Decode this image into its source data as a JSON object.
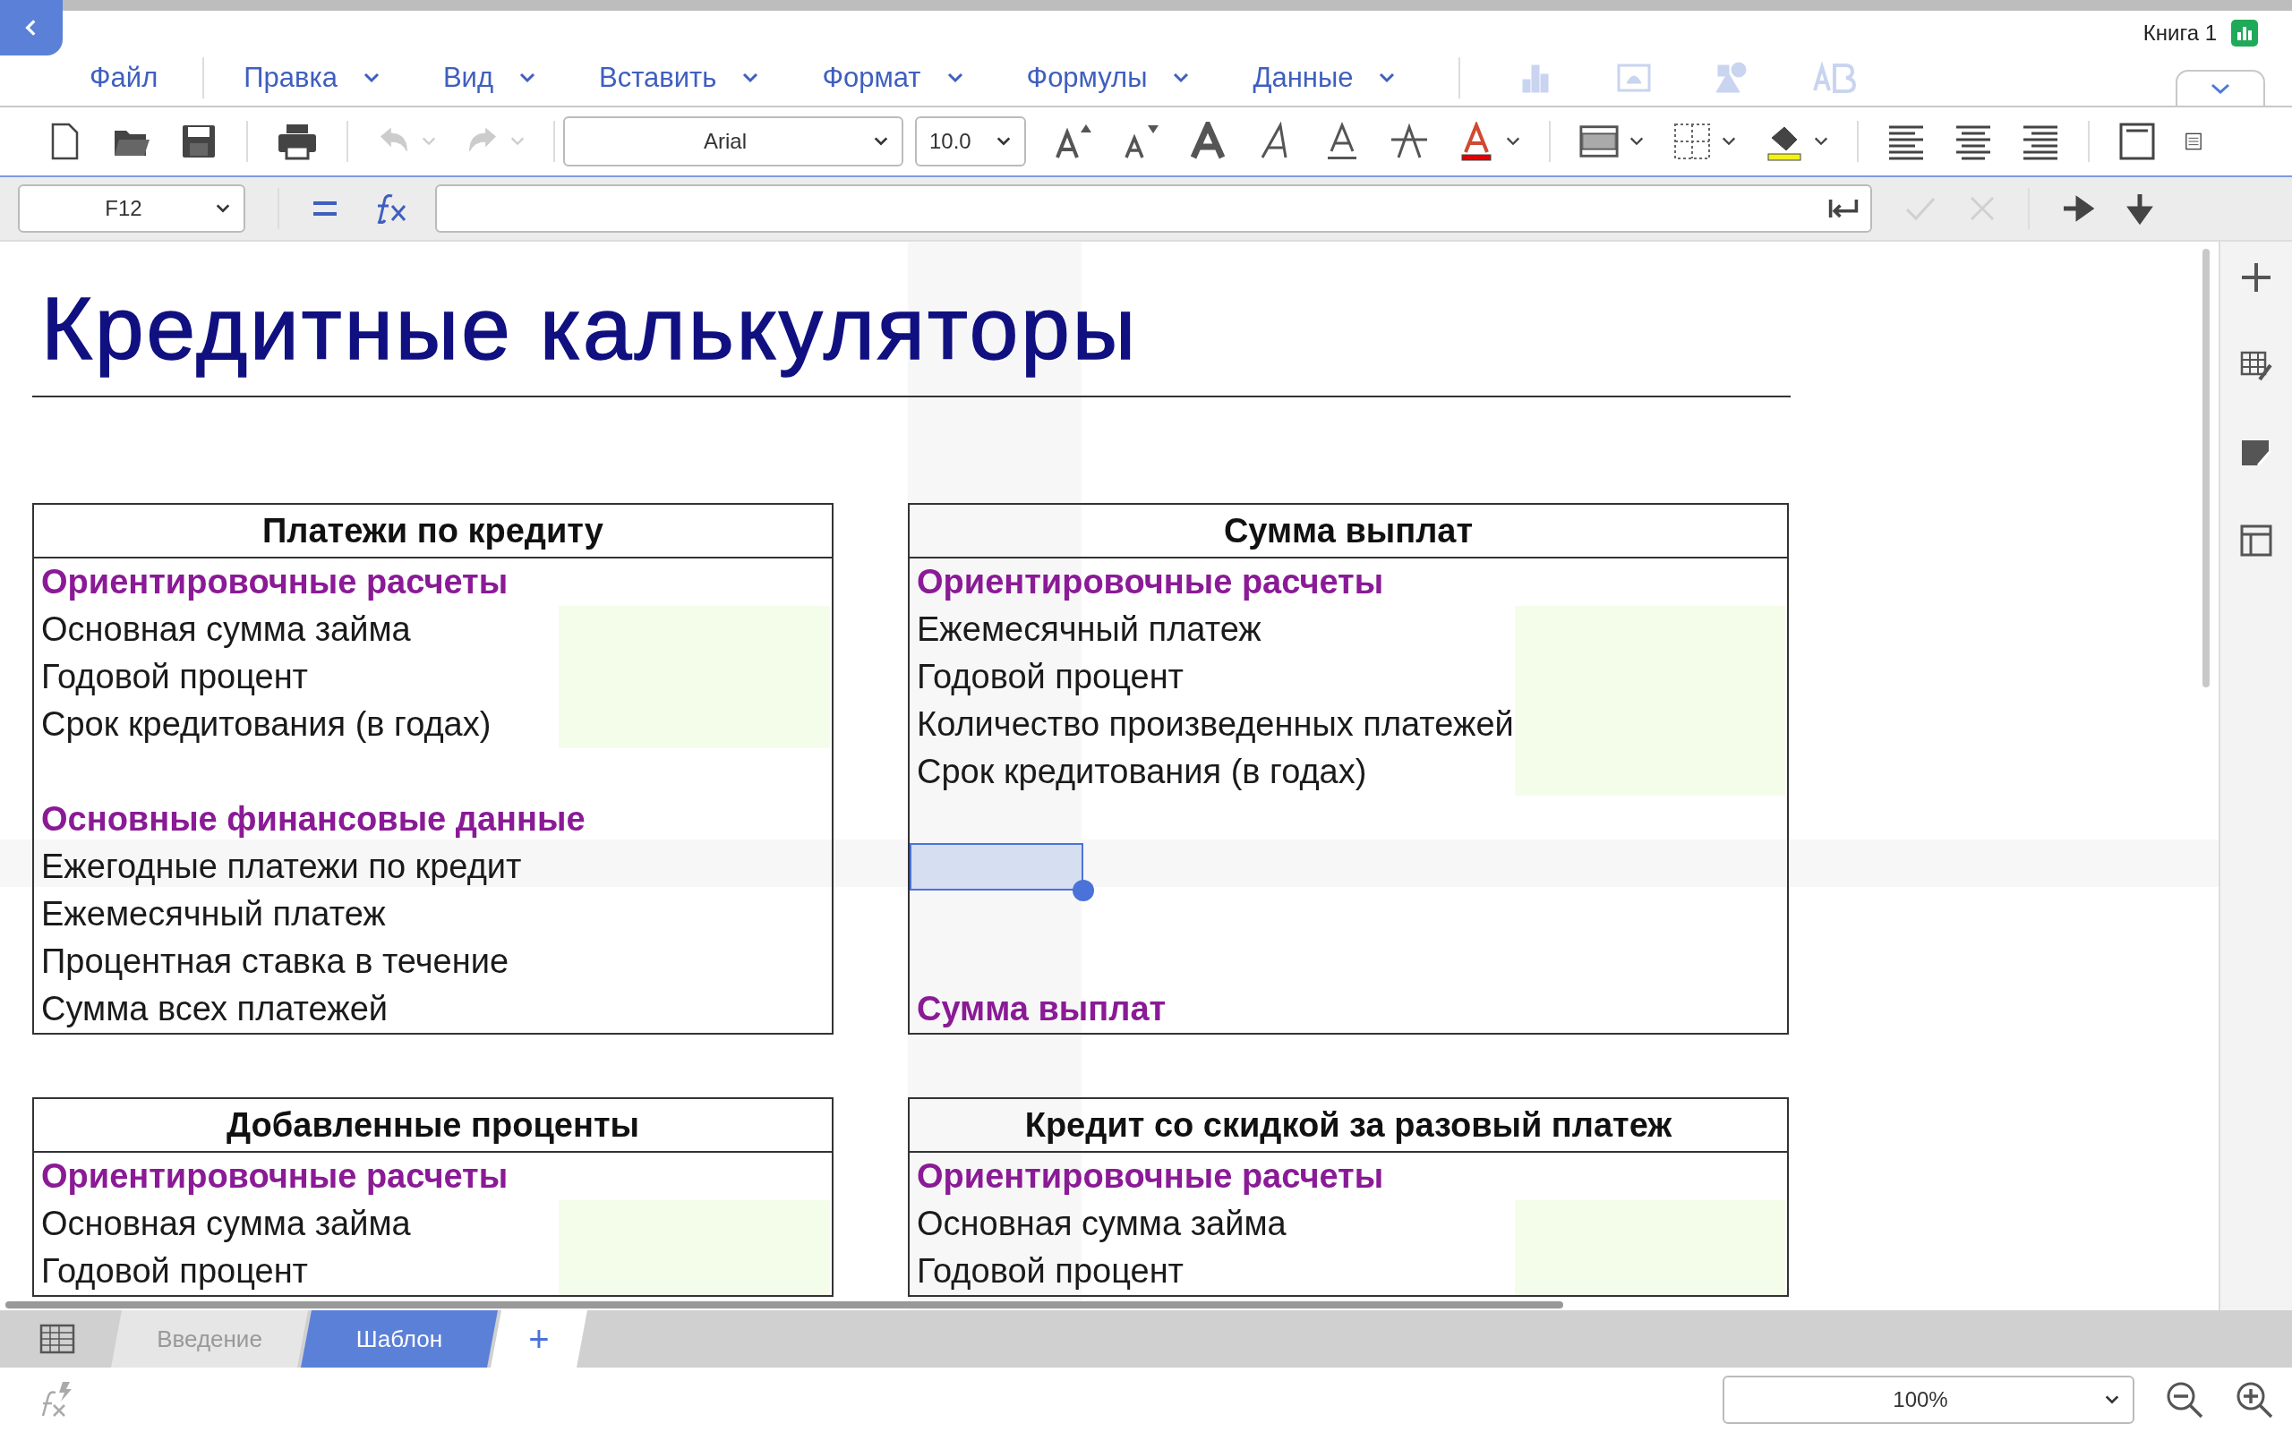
{
  "document_title": "Книга 1",
  "menu": [
    {
      "label": "Файл",
      "has_dropdown": false
    },
    {
      "label": "Правка",
      "has_dropdown": true
    },
    {
      "label": "Вид",
      "has_dropdown": true
    },
    {
      "label": "Вставить",
      "has_dropdown": true
    },
    {
      "label": "Формат",
      "has_dropdown": true
    },
    {
      "label": "Формулы",
      "has_dropdown": true
    },
    {
      "label": "Данные",
      "has_dropdown": true
    }
  ],
  "insert_tools_disabled": true,
  "toolbar": {
    "font": "Arial",
    "font_size": "10.0",
    "undo_disabled": true,
    "redo_disabled": true
  },
  "formula_bar": {
    "cell": "F12",
    "confirm_disabled": true,
    "cancel_disabled": true
  },
  "sheet": {
    "title": "Кредитные калькуляторы",
    "tables": [
      {
        "heading": "Платежи по кредиту",
        "rows": [
          {
            "kind": "section",
            "text": "Ориентировочные расчеты"
          },
          {
            "kind": "label",
            "text": "Основная сумма займа",
            "input": true
          },
          {
            "kind": "label",
            "text": "Годовой процент",
            "input": true
          },
          {
            "kind": "label",
            "text": "Срок кредитования (в годах)",
            "input": true
          },
          {
            "kind": "blank"
          },
          {
            "kind": "section",
            "text": "Основные финансовые данные"
          },
          {
            "kind": "label",
            "text": "Ежегодные платежи по кредит"
          },
          {
            "kind": "label",
            "text": "Ежемесячный платеж"
          },
          {
            "kind": "label",
            "text": "Процентная ставка в течение"
          },
          {
            "kind": "label",
            "text": "Сумма всех платежей"
          }
        ]
      },
      {
        "heading": "Сумма выплат",
        "rows": [
          {
            "kind": "section",
            "text": "Ориентировочные расчеты"
          },
          {
            "kind": "label",
            "text": "Ежемесячный платеж",
            "input": true
          },
          {
            "kind": "label",
            "text": "Годовой процент",
            "input": true
          },
          {
            "kind": "label",
            "text": "Количество произведенных платежей",
            "input": true
          },
          {
            "kind": "label",
            "text": "Срок кредитования (в годах)",
            "input": true
          },
          {
            "kind": "blank"
          },
          {
            "kind": "blank",
            "selected": true
          },
          {
            "kind": "blank"
          },
          {
            "kind": "blank"
          },
          {
            "kind": "section",
            "text": "Сумма выплат"
          }
        ]
      },
      {
        "heading": "Добавленные проценты",
        "rows": [
          {
            "kind": "section",
            "text": "Ориентировочные расчеты"
          },
          {
            "kind": "label",
            "text": "Основная сумма займа",
            "input": true
          },
          {
            "kind": "label",
            "text": "Годовой процент",
            "input": true
          }
        ]
      },
      {
        "heading": "Кредит со скидкой за разовый платеж",
        "rows": [
          {
            "kind": "section",
            "text": "Ориентировочные расчеты"
          },
          {
            "kind": "label",
            "text": "Основная сумма займа",
            "input": true
          },
          {
            "kind": "label",
            "text": "Годовой процент",
            "input": true
          }
        ]
      }
    ]
  },
  "sheet_tabs": [
    {
      "label": "Введение",
      "selected": false
    },
    {
      "label": "Шаблон",
      "selected": true
    }
  ],
  "add_sheet_label": "+",
  "zoom": "100%"
}
